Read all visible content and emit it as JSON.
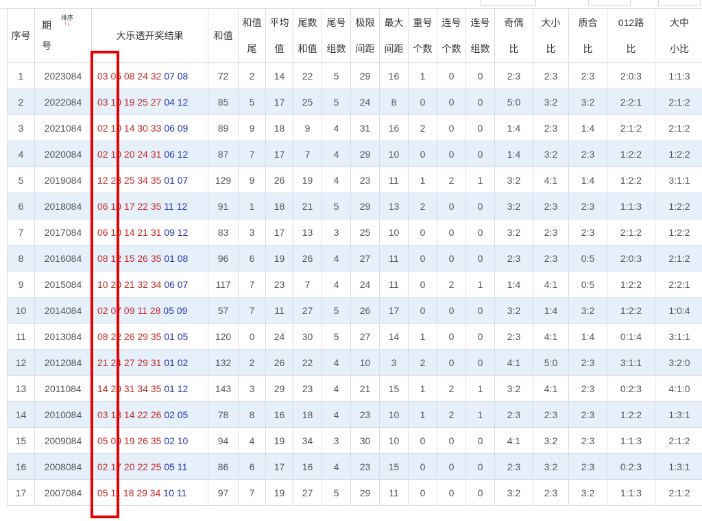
{
  "headers": {
    "seq": "序号",
    "period_top": "期",
    "period_bottom": "号",
    "sort_label": "排序",
    "sort_up": "↑",
    "sort_down": "↓",
    "result": "大乐透开奖结果",
    "sum": "和值",
    "cols": [
      {
        "top": "和值",
        "bottom": "尾"
      },
      {
        "top": "平均",
        "bottom": "值"
      },
      {
        "top": "尾数",
        "bottom": "和值"
      },
      {
        "top": "尾号",
        "bottom": "组数"
      },
      {
        "top": "极限",
        "bottom": "间距"
      },
      {
        "top": "最大",
        "bottom": "间距"
      },
      {
        "top": "重号",
        "bottom": "个数"
      },
      {
        "top": "连号",
        "bottom": "个数"
      },
      {
        "top": "连号",
        "bottom": "组数"
      },
      {
        "top": "奇偶",
        "bottom": "比"
      },
      {
        "top": "大小",
        "bottom": "比"
      },
      {
        "top": "质合",
        "bottom": "比"
      },
      {
        "top": "012路",
        "bottom": "比"
      },
      {
        "top": "大中",
        "bottom": "小比"
      }
    ]
  },
  "rows": [
    {
      "seq": "1",
      "period": "2023084",
      "red": "03 05 08 24 32",
      "blue": "07 08",
      "sum": "72",
      "vals": [
        "2",
        "14",
        "22",
        "5",
        "29",
        "16",
        "1",
        "0",
        "0",
        "2:3",
        "2:3",
        "2:3",
        "2:0:3",
        "1:1:3"
      ]
    },
    {
      "seq": "2",
      "period": "2022084",
      "red": "03 10 19 25 27",
      "blue": "04 12",
      "sum": "85",
      "vals": [
        "5",
        "17",
        "25",
        "5",
        "24",
        "8",
        "0",
        "0",
        "0",
        "5:0",
        "3:2",
        "3:2",
        "2:2:1",
        "2:1:2"
      ]
    },
    {
      "seq": "3",
      "period": "2021084",
      "red": "02 10 14 30 33",
      "blue": "06 09",
      "sum": "89",
      "vals": [
        "9",
        "18",
        "9",
        "4",
        "31",
        "16",
        "2",
        "0",
        "0",
        "1:4",
        "2:3",
        "1:4",
        "2:1:2",
        "2:1:2"
      ]
    },
    {
      "seq": "4",
      "period": "2020084",
      "red": "02 10 20 24 31",
      "blue": "06 12",
      "sum": "87",
      "vals": [
        "7",
        "17",
        "7",
        "4",
        "29",
        "10",
        "0",
        "0",
        "0",
        "1:4",
        "3:2",
        "2:3",
        "1:2:2",
        "1:2:2"
      ]
    },
    {
      "seq": "5",
      "period": "2019084",
      "red": "12 23 25 34 35",
      "blue": "01 07",
      "sum": "129",
      "vals": [
        "9",
        "26",
        "19",
        "4",
        "23",
        "11",
        "1",
        "2",
        "1",
        "3:2",
        "4:1",
        "1:4",
        "1:2:2",
        "3:1:1"
      ]
    },
    {
      "seq": "6",
      "period": "2018084",
      "red": "06 10 17 22 35",
      "blue": "11 12",
      "sum": "91",
      "vals": [
        "1",
        "18",
        "21",
        "5",
        "29",
        "13",
        "2",
        "0",
        "0",
        "3:2",
        "2:3",
        "2:3",
        "1:1:3",
        "1:2:2"
      ]
    },
    {
      "seq": "7",
      "period": "2017084",
      "red": "06 10 14 21 31",
      "blue": "09 12",
      "sum": "83",
      "vals": [
        "3",
        "17",
        "13",
        "3",
        "25",
        "10",
        "0",
        "0",
        "0",
        "3:2",
        "2:3",
        "2:3",
        "2:1:2",
        "1:2:2"
      ]
    },
    {
      "seq": "8",
      "period": "2016084",
      "red": "08 12 15 26 35",
      "blue": "01 08",
      "sum": "96",
      "vals": [
        "6",
        "19",
        "26",
        "4",
        "27",
        "11",
        "0",
        "0",
        "0",
        "2:3",
        "2:3",
        "0:5",
        "2:0:3",
        "2:1:2"
      ]
    },
    {
      "seq": "9",
      "period": "2015084",
      "red": "10 20 21 32 34",
      "blue": "06 07",
      "sum": "117",
      "vals": [
        "7",
        "23",
        "7",
        "4",
        "24",
        "11",
        "0",
        "2",
        "1",
        "1:4",
        "4:1",
        "0:5",
        "1:2:2",
        "2:2:1"
      ]
    },
    {
      "seq": "10",
      "period": "2014084",
      "red": "02 07 09 11 28",
      "blue": "05 09",
      "sum": "57",
      "vals": [
        "7",
        "11",
        "27",
        "5",
        "26",
        "17",
        "0",
        "0",
        "0",
        "3:2",
        "1:4",
        "3:2",
        "1:2:2",
        "1:0:4"
      ]
    },
    {
      "seq": "11",
      "period": "2013084",
      "red": "08 22 26 29 35",
      "blue": "01 05",
      "sum": "120",
      "vals": [
        "0",
        "24",
        "30",
        "5",
        "27",
        "14",
        "1",
        "0",
        "0",
        "2:3",
        "4:1",
        "1:4",
        "0:1:4",
        "3:1:1"
      ]
    },
    {
      "seq": "12",
      "period": "2012084",
      "red": "21 24 27 29 31",
      "blue": "01 02",
      "sum": "132",
      "vals": [
        "2",
        "26",
        "22",
        "4",
        "10",
        "3",
        "2",
        "0",
        "0",
        "4:1",
        "5:0",
        "2:3",
        "3:1:1",
        "3:2:0"
      ]
    },
    {
      "seq": "13",
      "period": "2011084",
      "red": "14 29 31 34 35",
      "blue": "01 12",
      "sum": "143",
      "vals": [
        "3",
        "29",
        "23",
        "4",
        "21",
        "15",
        "1",
        "2",
        "1",
        "3:2",
        "4:1",
        "2:3",
        "0:2:3",
        "4:1:0"
      ]
    },
    {
      "seq": "14",
      "period": "2010084",
      "red": "03 13 14 22 26",
      "blue": "02 05",
      "sum": "78",
      "vals": [
        "8",
        "16",
        "18",
        "4",
        "23",
        "10",
        "1",
        "2",
        "1",
        "2:3",
        "2:3",
        "2:3",
        "1:2:2",
        "1:3:1"
      ]
    },
    {
      "seq": "15",
      "period": "2009084",
      "red": "05 09 19 26 35",
      "blue": "02 10",
      "sum": "94",
      "vals": [
        "4",
        "19",
        "34",
        "3",
        "30",
        "10",
        "0",
        "0",
        "0",
        "4:1",
        "3:2",
        "2:3",
        "1:1:3",
        "2:1:2"
      ]
    },
    {
      "seq": "16",
      "period": "2008084",
      "red": "02 17 20 22 25",
      "blue": "05 11",
      "sum": "86",
      "vals": [
        "6",
        "17",
        "16",
        "4",
        "23",
        "15",
        "0",
        "0",
        "0",
        "2:3",
        "3:2",
        "2:3",
        "0:2:3",
        "1:3:1"
      ]
    },
    {
      "seq": "17",
      "period": "2007084",
      "red": "05 11 18 29 34",
      "blue": "10 11",
      "sum": "97",
      "vals": [
        "7",
        "19",
        "27",
        "5",
        "29",
        "11",
        "0",
        "0",
        "0",
        "3:2",
        "2:3",
        "3:2",
        "1:1:3",
        "2:1:2"
      ]
    }
  ],
  "colors": {
    "red_ball": "#c8282a",
    "blue_ball": "#2233bb",
    "row_alt": "#e5f0fb",
    "highlight": "#e60000"
  }
}
